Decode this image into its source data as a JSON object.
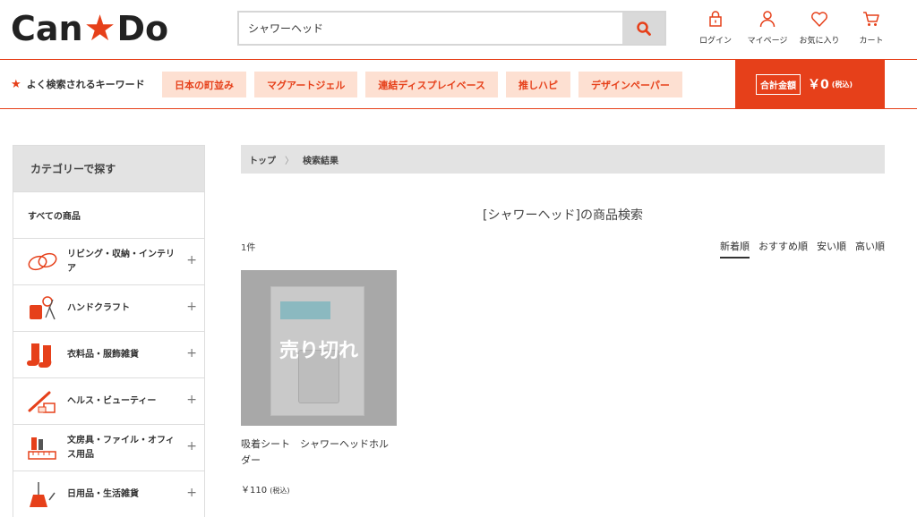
{
  "header": {
    "logo_left": "Can",
    "logo_right": "Do",
    "search_value": "シャワーヘッド",
    "nav": [
      {
        "label": "ログイン",
        "icon": "lock-icon"
      },
      {
        "label": "マイページ",
        "icon": "user-icon"
      },
      {
        "label": "お気に入り",
        "icon": "heart-icon"
      },
      {
        "label": "カート",
        "icon": "cart-icon"
      }
    ]
  },
  "keywords": {
    "title": "よく検索されるキーワード",
    "tags": [
      "日本の町並み",
      "マグアートジェル",
      "連結ディスプレイベース",
      "推しハピ",
      "デザインペーパー"
    ]
  },
  "cart_total": {
    "label": "合計金額",
    "amount": "￥0",
    "tax": "(税込)"
  },
  "sidebar": {
    "heading": "カテゴリーで探す",
    "all_label": "すべての商品",
    "items": [
      {
        "label": "リビング・収納・インテリア",
        "icon": "living-icon"
      },
      {
        "label": "ハンドクラフト",
        "icon": "handcraft-icon"
      },
      {
        "label": "衣料品・服飾雑貨",
        "icon": "socks-icon"
      },
      {
        "label": "ヘルス・ビューティー",
        "icon": "beauty-icon"
      },
      {
        "label": "文房具・ファイル・オフィス用品",
        "icon": "stationery-icon"
      },
      {
        "label": "日用品・生活雑貨",
        "icon": "broom-icon"
      }
    ]
  },
  "breadcrumb": {
    "home": "トップ",
    "current": "検索結果"
  },
  "results": {
    "title": "[シャワーヘッド]の商品検索",
    "count": "1件",
    "sorts": [
      "新着順",
      "おすすめ順",
      "安い順",
      "高い順"
    ]
  },
  "product": {
    "overlay": "売り切れ",
    "name": "吸着シート　シャワーヘッドホルダー",
    "price": "￥110",
    "tax": "(税込)"
  },
  "colors": {
    "accent": "#e6401a",
    "tag_bg": "#fde0d2"
  }
}
